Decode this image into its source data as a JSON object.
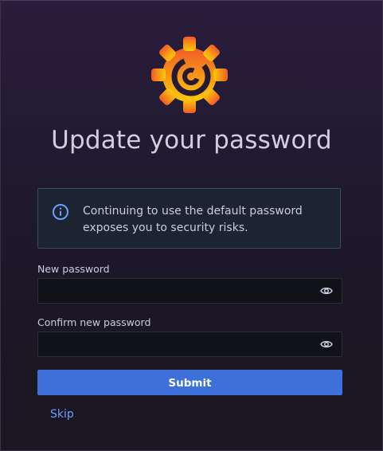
{
  "title": "Update your password",
  "logo": {
    "icon": "grafana-logo-icon"
  },
  "alert": {
    "icon": "info-circle-icon",
    "text": "Continuing to use the default password exposes you to security risks."
  },
  "form": {
    "new_password": {
      "label": "New password",
      "value": "",
      "icon": "eye-icon"
    },
    "confirm_password": {
      "label": "Confirm new password",
      "value": "",
      "icon": "eye-icon"
    },
    "submit_label": "Submit",
    "skip_label": "Skip"
  },
  "colors": {
    "accent": "#3d71d9",
    "link": "#6e9fff",
    "info": "#6e9fff",
    "logo_orange": "#f46800",
    "logo_yellow": "#fbca0a"
  }
}
